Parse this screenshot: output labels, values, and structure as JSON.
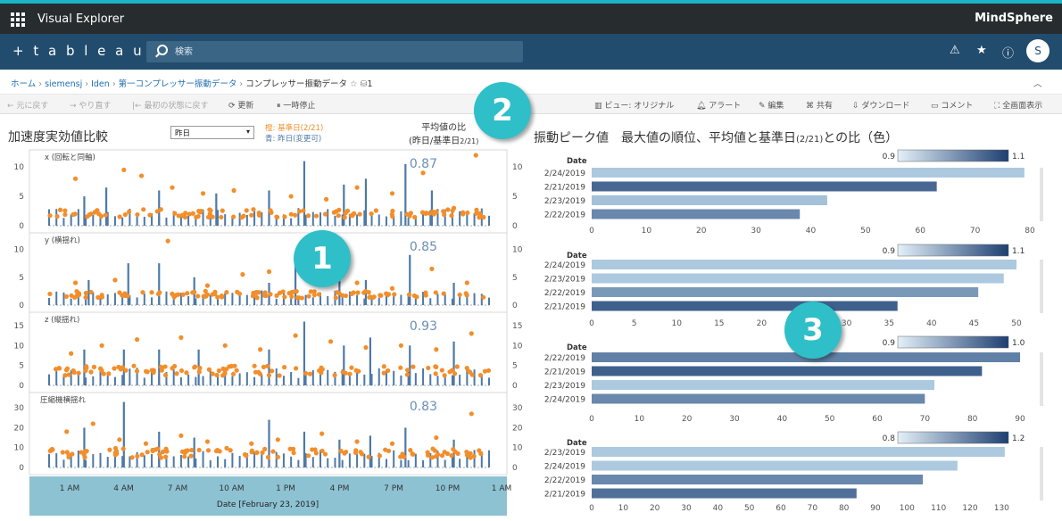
{
  "topbar": {
    "app_title": "Visual Explorer",
    "brand": "MindSphere"
  },
  "navbar": {
    "logo": "+ t a b l e a u",
    "search_placeholder": "検索",
    "icons": [
      "alert-icon",
      "star-icon",
      "info-icon"
    ],
    "avatar_initial": "S"
  },
  "breadcrumb": {
    "items": [
      "ホーム",
      "siemensj",
      "Iden",
      "第一コンプレッサー振動データ"
    ],
    "current": "コンプレッサー振動データ",
    "count": "1"
  },
  "toolbar": {
    "undo": "元に戻す",
    "redo": "やり直す",
    "revert": "最初の状態に戻す",
    "refresh": "更新",
    "pause": "一時停止",
    "view": "ビュー: オリジナル",
    "alert": "アラート",
    "edit": "編集",
    "share": "共有",
    "download": "ダウンロード",
    "comment": "コメント",
    "fullscreen": "全画面表示"
  },
  "left": {
    "title": "加速度実効値比較",
    "selector_value": "昨日",
    "legend_orange": "橙: 基準日(2/21)",
    "legend_blue": "青: 昨日(変更可)",
    "mean_header_1": "平均値の比",
    "mean_header_2": "(昨日/基準日",
    "mean_header_3": "2/21)",
    "x_title": "Date [February 23, 2019]",
    "x_ticks": [
      "1 AM",
      "4 AM",
      "7 AM",
      "10 AM",
      "1 PM",
      "4 PM",
      "7 PM",
      "10 PM",
      "1 AM"
    ]
  },
  "right": {
    "title": "振動ピーク値　最大値の順位、平均値と基準日",
    "title_small": "(2/21)",
    "title_tail": "との比（色）"
  },
  "colors": {
    "orange": "#f28e2b",
    "blue": "#4e79a7",
    "bubble": "#2fbfc8"
  },
  "callouts": [
    "1",
    "2",
    "3"
  ],
  "chart_data": [
    {
      "type": "line",
      "title": "x (回転と同軸)",
      "ratio": "0.87",
      "ylim": [
        0,
        12
      ],
      "y_ticks_left": [
        "10",
        "5",
        "0"
      ],
      "y_ticks_right": [
        "10",
        "5",
        "0"
      ],
      "series": [
        {
          "name": "青: 昨日(変更可)",
          "spikes_x": [
            0.08,
            0.13,
            0.25,
            0.38,
            0.5,
            0.58,
            0.67,
            0.72,
            0.81,
            0.87
          ],
          "spikes_y": [
            5,
            6.5,
            6,
            5.5,
            6,
            11,
            7,
            8,
            10.5,
            6
          ],
          "baseline": 2
        },
        {
          "name": "橙: 基準日(2/21)",
          "baseline": 2,
          "outliers_x": [
            0.06,
            0.17,
            0.21,
            0.28,
            0.35,
            0.42,
            0.55,
            0.63,
            0.7,
            0.78,
            0.85,
            0.92,
            0.97
          ],
          "outliers_y": [
            8,
            9.5,
            8.5,
            6.5,
            5.5,
            6,
            5,
            4.5,
            6.5,
            5.5,
            9,
            3,
            12
          ]
        }
      ]
    },
    {
      "type": "line",
      "title": "y (横揺れ)",
      "ratio": "0.85",
      "ylim": [
        0,
        12
      ],
      "y_ticks_left": [
        "10",
        "5",
        "0"
      ],
      "y_ticks_right": [
        "10",
        "5",
        "0"
      ],
      "series": [
        {
          "name": "青: 昨日(変更可)",
          "spikes_x": [
            0.09,
            0.18,
            0.25,
            0.33,
            0.5,
            0.56,
            0.66,
            0.72,
            0.82,
            0.92
          ],
          "spikes_y": [
            4.5,
            7.5,
            7.5,
            5,
            4,
            8,
            7,
            4.5,
            9,
            4
          ],
          "baseline": 1.8
        },
        {
          "name": "橙: 基準日(2/21)",
          "baseline": 1.8,
          "outliers_x": [
            0.06,
            0.15,
            0.27,
            0.36,
            0.44,
            0.5,
            0.6,
            0.7,
            0.78,
            0.87,
            0.95
          ],
          "outliers_y": [
            4,
            4.5,
            11.5,
            3.5,
            5.5,
            6,
            7.5,
            4,
            3,
            6.5,
            4
          ]
        }
      ]
    },
    {
      "type": "line",
      "title": "z (縦揺れ)",
      "ratio": "0.93",
      "ylim": [
        0,
        17
      ],
      "y_ticks_left": [
        "15",
        "10",
        "5",
        "0"
      ],
      "y_ticks_right": [
        "15",
        "10",
        "5",
        "0"
      ],
      "series": [
        {
          "name": "青: 昨日(変更可)",
          "spikes_x": [
            0.08,
            0.17,
            0.25,
            0.34,
            0.5,
            0.58,
            0.67,
            0.73,
            0.82,
            0.92
          ],
          "spikes_y": [
            9,
            9,
            9,
            9,
            9,
            16,
            10,
            12,
            10,
            11
          ],
          "baseline": 3
        },
        {
          "name": "橙: 基準日(2/21)",
          "baseline": 3.5,
          "outliers_x": [
            0.05,
            0.12,
            0.2,
            0.3,
            0.4,
            0.48,
            0.56,
            0.64,
            0.72,
            0.8,
            0.88,
            0.96
          ],
          "outliers_y": [
            8,
            10,
            11.5,
            12,
            10,
            9,
            12.5,
            11,
            9.5,
            10,
            9,
            13
          ]
        }
      ]
    },
    {
      "type": "line",
      "title": "圧縮機横揺れ",
      "ratio": "0.83",
      "ylim": [
        0,
        35
      ],
      "y_ticks_left": [
        "30",
        "20",
        "10",
        "0"
      ],
      "y_ticks_right": [
        "30",
        "20",
        "10",
        "0"
      ],
      "series": [
        {
          "name": "青: 昨日(変更可)",
          "spikes_x": [
            0.08,
            0.17,
            0.25,
            0.33,
            0.5,
            0.58,
            0.66,
            0.73,
            0.81,
            0.92
          ],
          "spikes_y": [
            20,
            33,
            18,
            15,
            24,
            18,
            14,
            16,
            20,
            14
          ],
          "baseline": 6
        },
        {
          "name": "橙: 基準日(2/21)",
          "baseline": 7,
          "outliers_x": [
            0.04,
            0.1,
            0.16,
            0.22,
            0.3,
            0.36,
            0.46,
            0.52,
            0.62,
            0.7,
            0.78,
            0.88,
            0.96
          ],
          "outliers_y": [
            18,
            22,
            14,
            12,
            16,
            13,
            12,
            14,
            17,
            13,
            12,
            15,
            27
          ]
        }
      ]
    },
    {
      "type": "bar",
      "title": "Date",
      "color_range": [
        "0.9",
        "1.1"
      ],
      "categories": [
        "2/24/2019",
        "2/21/2019",
        "2/23/2019",
        "2/22/2019"
      ],
      "values": [
        79,
        63,
        43,
        38
      ],
      "shades": [
        0.15,
        0.75,
        0.2,
        0.55
      ],
      "xlim": [
        0,
        80
      ],
      "x_ticks": [
        "0",
        "10",
        "20",
        "30",
        "40",
        "50",
        "60",
        "70",
        "80"
      ]
    },
    {
      "type": "bar",
      "title": "Date",
      "color_range": [
        "0.9",
        "1.1"
      ],
      "categories": [
        "2/24/2019",
        "2/23/2019",
        "2/22/2019",
        "2/21/2019"
      ],
      "values": [
        50,
        48.5,
        45.5,
        36
      ],
      "shades": [
        0.15,
        0.15,
        0.45,
        0.8
      ],
      "xlim": [
        0,
        50
      ],
      "x_ticks": [
        "0",
        "5",
        "10",
        "15",
        "20",
        "25",
        "30",
        "35",
        "40",
        "45",
        "50"
      ]
    },
    {
      "type": "bar",
      "title": "Date",
      "color_range": [
        "0.9",
        "1.0"
      ],
      "categories": [
        "2/22/2019",
        "2/21/2019",
        "2/23/2019",
        "2/24/2019"
      ],
      "values": [
        90,
        82,
        72,
        70
      ],
      "shades": [
        0.6,
        0.8,
        0.15,
        0.55
      ],
      "xlim": [
        0,
        90
      ],
      "x_ticks": [
        "0",
        "10",
        "20",
        "30",
        "40",
        "50",
        "60",
        "70",
        "80",
        "90"
      ]
    },
    {
      "type": "bar",
      "title": "Date",
      "color_range": [
        "0.8",
        "1.2"
      ],
      "categories": [
        "2/23/2019",
        "2/24/2019",
        "2/22/2019",
        "2/21/2019"
      ],
      "values": [
        131,
        116,
        105,
        84
      ],
      "shades": [
        0.15,
        0.15,
        0.55,
        0.7
      ],
      "xlim": [
        0,
        135
      ],
      "x_ticks": [
        "0",
        "10",
        "20",
        "30",
        "40",
        "50",
        "60",
        "70",
        "80",
        "90",
        "100",
        "110",
        "120",
        "130"
      ]
    }
  ]
}
